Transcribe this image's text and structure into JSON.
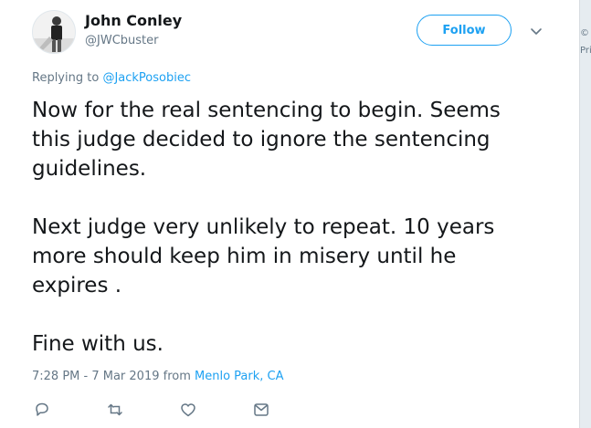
{
  "author": {
    "name": "John Conley",
    "handle": "@JWCbuster",
    "avatar_icon": "avatar-photo"
  },
  "follow_label": "Follow",
  "reply_context": {
    "prefix": "Replying to ",
    "mention": "@JackPosobiec"
  },
  "tweet_lines": [
    "Now for the real sentencing to begin. Seems",
    "this judge decided to ignore the sentencing",
    "guidelines.",
    "",
    "Next judge very unlikely to repeat. 10 years",
    "more should keep him in misery until he",
    "expires .",
    "",
    "Fine with us."
  ],
  "timestamp": {
    "time_date": "7:28 PM - 7 Mar 2019 from ",
    "location": "Menlo Park, CA"
  },
  "actions": [
    {
      "name": "reply-icon"
    },
    {
      "name": "retweet-icon"
    },
    {
      "name": "like-icon"
    },
    {
      "name": "message-icon"
    }
  ],
  "side_fragments": [
    "©",
    "Pri"
  ],
  "colors": {
    "accent": "#1da1f2",
    "secondary_text": "#657786",
    "primary_text": "#14171a"
  }
}
